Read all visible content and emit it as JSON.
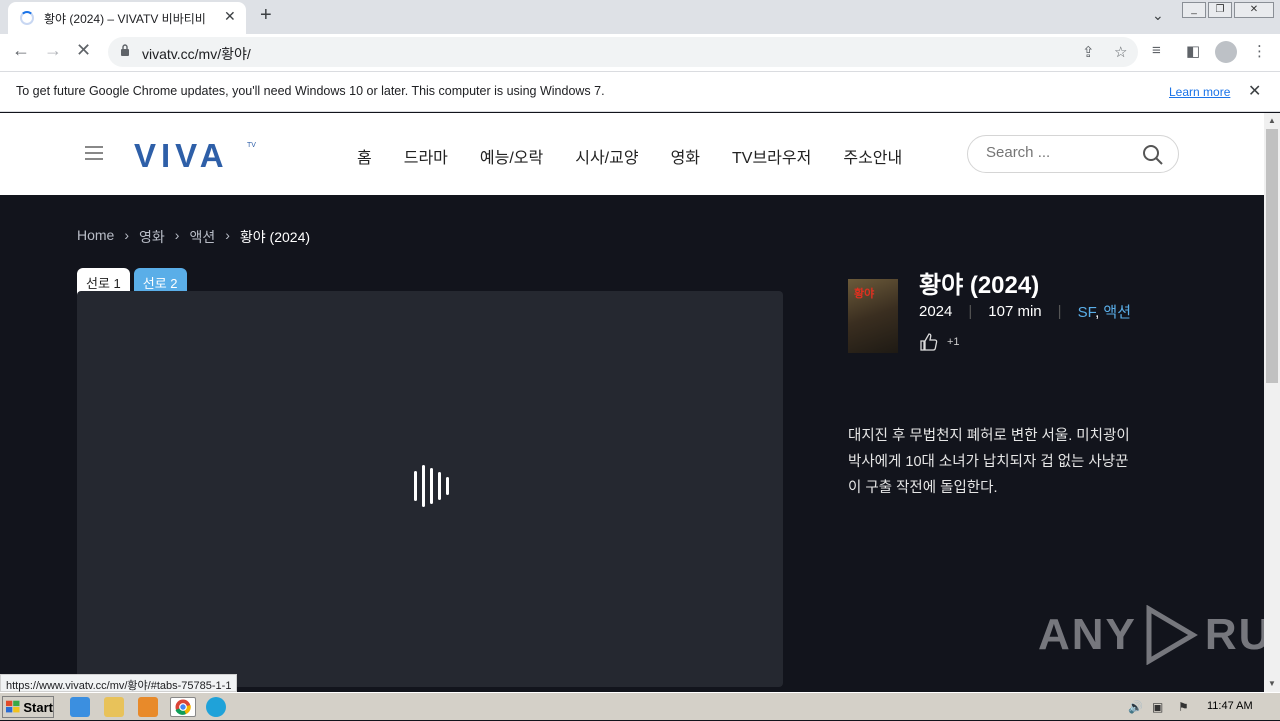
{
  "browser": {
    "tab_title": "황야 (2024) – VIVATV 비바티비",
    "url": "vivatv.cc/mv/황야/",
    "infobar_text": "To get future Google Chrome updates, you'll need Windows 10 or later. This computer is using Windows 7.",
    "learn_more": "Learn more",
    "status_url": "https://www.vivatv.cc/mv/황야/#tabs-75785-1-1"
  },
  "site": {
    "logo_text": "VIVA",
    "logo_tv": "TV",
    "menu": [
      "홈",
      "드라마",
      "예능/오락",
      "시사/교양",
      "영화",
      "TV브라우저",
      "주소안내"
    ],
    "search_placeholder": "Search ..."
  },
  "breadcrumb": [
    "Home",
    "영화",
    "액션",
    "황야 (2024)"
  ],
  "servers": [
    "선로 1",
    "선로 2"
  ],
  "movie": {
    "title": "황야 (2024)",
    "year": "2024",
    "runtime": "107 min",
    "genre_1": "SF",
    "genre_sep": ",",
    "genre_2": "액션",
    "likes": "+1",
    "poster_text": "황야",
    "description": "대지진 후 무법천지 폐허로 변한 서울. 미치광이 박사에게 10대 소녀가 납치되자 겁 없는 사냥꾼이 구출 작전에 돌입한다."
  },
  "watermark": {
    "left": "ANY",
    "right": "RUN"
  },
  "taskbar": {
    "start_label": "Start",
    "clock": "11:47 AM"
  },
  "colors": {
    "accent": "#5aaee8",
    "logo": "#2e5fa8",
    "background": "#12141c"
  }
}
